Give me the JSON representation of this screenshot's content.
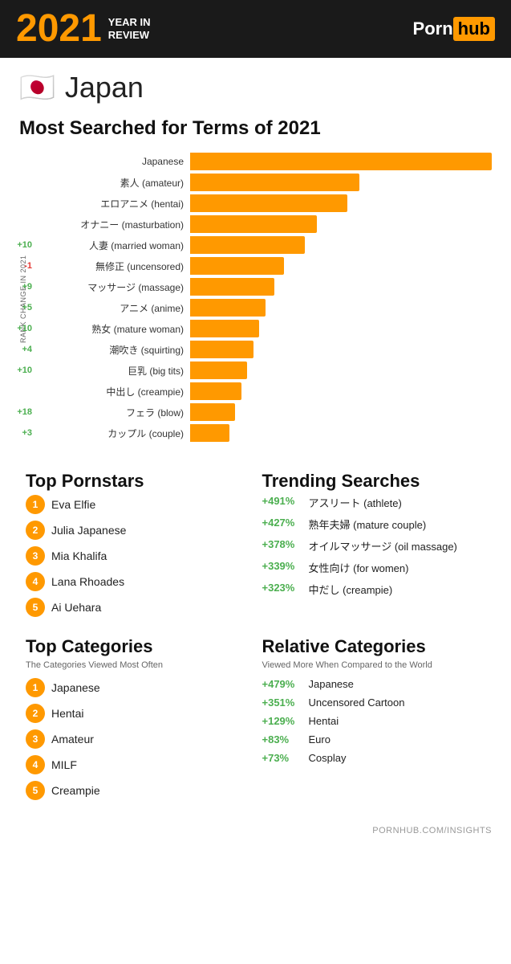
{
  "header": {
    "year": "2021",
    "year_in_review_line1": "YEAR IN",
    "year_in_review_line2": "REVIEW",
    "logo_porn": "Porn",
    "logo_hub": "hub"
  },
  "country": {
    "name": "Japan",
    "flag": "🇯🇵"
  },
  "chart": {
    "title": "Most Searched for Terms of 2021",
    "y_axis_label": "RANK CHANGE IN 2021",
    "bars": [
      {
        "label": "Japanese",
        "width_pct": 100,
        "rank_change": null
      },
      {
        "label": "素人 (amateur)",
        "width_pct": 56,
        "rank_change": null
      },
      {
        "label": "エロアニメ (hentai)",
        "width_pct": 52,
        "rank_change": null
      },
      {
        "label": "オナニー (masturbation)",
        "width_pct": 42,
        "rank_change": null
      },
      {
        "label": "人妻 (married woman)",
        "width_pct": 38,
        "rank_change": "+10"
      },
      {
        "label": "無修正 (uncensored)",
        "width_pct": 31,
        "rank_change": "-1"
      },
      {
        "label": "マッサージ (massage)",
        "width_pct": 28,
        "rank_change": "+9"
      },
      {
        "label": "アニメ (anime)",
        "width_pct": 25,
        "rank_change": "+5"
      },
      {
        "label": "熟女 (mature woman)",
        "width_pct": 23,
        "rank_change": "+10"
      },
      {
        "label": "潮吹き (squirting)",
        "width_pct": 21,
        "rank_change": "+4"
      },
      {
        "label": "巨乳 (big tits)",
        "width_pct": 19,
        "rank_change": "+10"
      },
      {
        "label": "中出し (creampie)",
        "width_pct": 17,
        "rank_change": null
      },
      {
        "label": "フェラ (blow)",
        "width_pct": 15,
        "rank_change": "+18"
      },
      {
        "label": "カップル (couple)",
        "width_pct": 13,
        "rank_change": "+3"
      }
    ]
  },
  "top_pornstars": {
    "title": "Top Pornstars",
    "items": [
      {
        "rank": 1,
        "name": "Eva Elfie"
      },
      {
        "rank": 2,
        "name": "Julia Japanese"
      },
      {
        "rank": 3,
        "name": "Mia Khalifa"
      },
      {
        "rank": 4,
        "name": "Lana Rhoades"
      },
      {
        "rank": 5,
        "name": "Ai Uehara"
      }
    ]
  },
  "trending_searches": {
    "title": "Trending Searches",
    "items": [
      {
        "pct": "+491%",
        "label": "アスリート (athlete)"
      },
      {
        "pct": "+427%",
        "label": "熟年夫婦 (mature couple)"
      },
      {
        "pct": "+378%",
        "label": "オイルマッサージ (oil massage)"
      },
      {
        "pct": "+339%",
        "label": "女性向け (for women)"
      },
      {
        "pct": "+323%",
        "label": "中だし (creampie)"
      }
    ]
  },
  "top_categories": {
    "title": "Top Categories",
    "subtitle": "The Categories Viewed Most Often",
    "items": [
      {
        "rank": 1,
        "name": "Japanese"
      },
      {
        "rank": 2,
        "name": "Hentai"
      },
      {
        "rank": 3,
        "name": "Amateur"
      },
      {
        "rank": 4,
        "name": "MILF"
      },
      {
        "rank": 5,
        "name": "Creampie"
      }
    ]
  },
  "relative_categories": {
    "title": "Relative Categories",
    "subtitle": "Viewed More When Compared to the World",
    "items": [
      {
        "pct": "+479%",
        "label": "Japanese"
      },
      {
        "pct": "+351%",
        "label": "Uncensored Cartoon"
      },
      {
        "pct": "+129%",
        "label": "Hentai"
      },
      {
        "pct": "+83%",
        "label": "Euro"
      },
      {
        "pct": "+73%",
        "label": "Cosplay"
      }
    ]
  },
  "footer": {
    "url": "PORNHUB.COM/INSIGHTS"
  }
}
